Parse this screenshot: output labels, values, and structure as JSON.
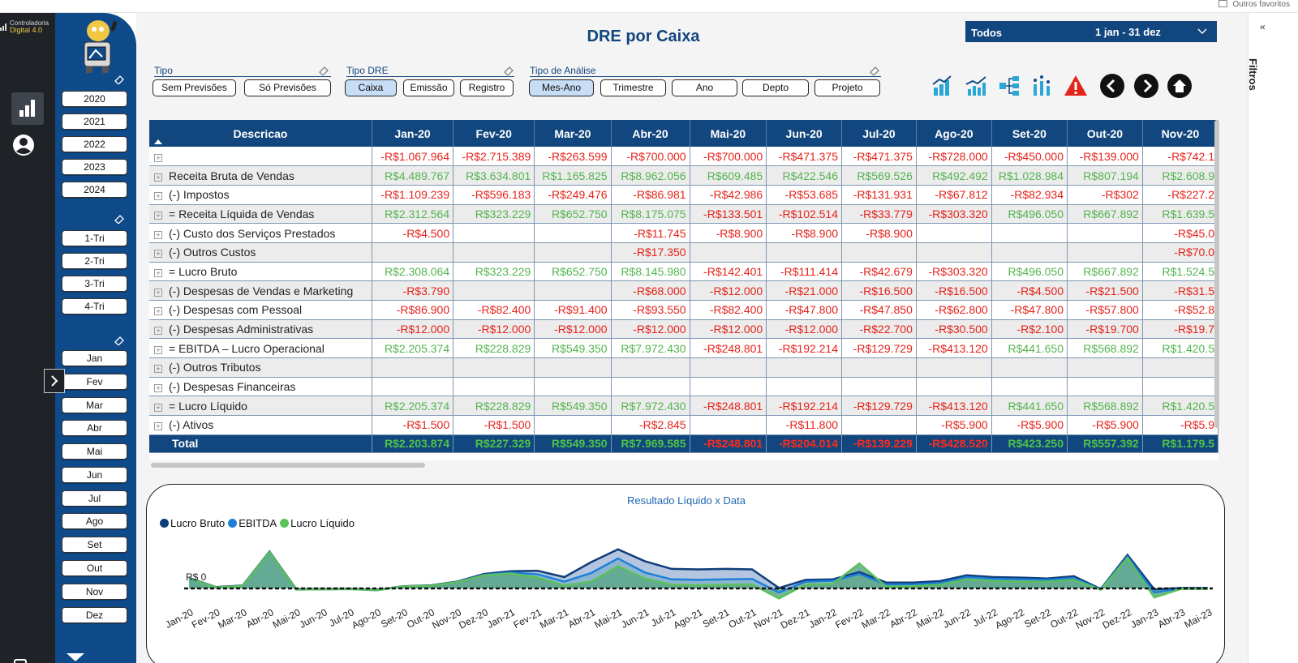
{
  "browser": {
    "favorites_label": "Outros favoritos"
  },
  "brand": {
    "line1": "Controladoria",
    "line2": "Digital 4.0"
  },
  "header": {
    "title": "DRE por Caixa",
    "date_filter": {
      "scope": "Todos",
      "range": "1 jan - 31 dez"
    }
  },
  "left_panel": {
    "years": [
      "2020",
      "2021",
      "2022",
      "2023",
      "2024"
    ],
    "quarters": [
      "1-Tri",
      "2-Tri",
      "3-Tri",
      "4-Tri"
    ],
    "months": [
      "Jan",
      "Fev",
      "Mar",
      "Abr",
      "Mai",
      "Jun",
      "Jul",
      "Ago",
      "Set",
      "Out",
      "Nov",
      "Dez"
    ]
  },
  "filters": {
    "tipo": {
      "label": "Tipo",
      "options": [
        "Sem Previsões",
        "Só Previsões"
      ]
    },
    "tipo_dre": {
      "label": "Tipo DRE",
      "options": [
        "Caixa",
        "Emissão",
        "Registro"
      ],
      "selected": "Caixa"
    },
    "tipo_analise": {
      "label": "Tipo de Análise",
      "options": [
        "Mes-Ano",
        "Trimestre",
        "Ano",
        "Depto",
        "Projeto"
      ],
      "selected": "Mes-Ano"
    }
  },
  "table": {
    "columns": [
      "Descricao",
      "Jan-20",
      "Fev-20",
      "Mar-20",
      "Abr-20",
      "Mai-20",
      "Jun-20",
      "Jul-20",
      "Ago-20",
      "Set-20",
      "Out-20",
      "Nov-20"
    ],
    "rows": [
      {
        "label": "",
        "values": [
          "-R$1.067.964",
          "-R$2.715.389",
          "-R$263.599",
          "-R$700.000",
          "-R$700.000",
          "-R$471.375",
          "-R$471.375",
          "-R$728.000",
          "-R$450.000",
          "-R$139.000",
          "-R$742.1"
        ]
      },
      {
        "label": "Receita Bruta de Vendas",
        "values": [
          "R$4.489.767",
          "R$3.634.801",
          "R$1.165.825",
          "R$8.962.056",
          "R$609.485",
          "R$422.546",
          "R$569.526",
          "R$492.492",
          "R$1.028.984",
          "R$807.194",
          "R$2.608.9"
        ]
      },
      {
        "label": "(-) Impostos",
        "values": [
          "-R$1.109.239",
          "-R$596.183",
          "-R$249.476",
          "-R$86.981",
          "-R$42.986",
          "-R$53.685",
          "-R$131.931",
          "-R$67.812",
          "-R$82.934",
          "-R$302",
          "-R$227.2"
        ]
      },
      {
        "label": "= Receita Líquida de Vendas",
        "values": [
          "R$2.312.564",
          "R$323.229",
          "R$652.750",
          "R$8.175.075",
          "-R$133.501",
          "-R$102.514",
          "-R$33.779",
          "-R$303.320",
          "R$496.050",
          "R$667.892",
          "R$1.639.5"
        ]
      },
      {
        "label": "(-) Custo dos Serviços Prestados",
        "values": [
          "-R$4.500",
          "",
          "",
          "-R$11.745",
          "-R$8.900",
          "-R$8.900",
          "-R$8.900",
          "",
          "",
          "",
          "-R$45.0"
        ]
      },
      {
        "label": "(-) Outros Custos",
        "values": [
          "",
          "",
          "",
          "-R$17.350",
          "",
          "",
          "",
          "",
          "",
          "",
          "-R$70.0"
        ]
      },
      {
        "label": "= Lucro Bruto",
        "values": [
          "R$2.308.064",
          "R$323.229",
          "R$652.750",
          "R$8.145.980",
          "-R$142.401",
          "-R$111.414",
          "-R$42.679",
          "-R$303.320",
          "R$496.050",
          "R$667.892",
          "R$1.524.5"
        ]
      },
      {
        "label": "(-) Despesas de Vendas e Marketing",
        "values": [
          "-R$3.790",
          "",
          "",
          "-R$68.000",
          "-R$12.000",
          "-R$21.000",
          "-R$16.500",
          "-R$16.500",
          "-R$4.500",
          "-R$21.500",
          "-R$31.5"
        ]
      },
      {
        "label": "(-) Despesas com Pessoal",
        "values": [
          "-R$86.900",
          "-R$82.400",
          "-R$91.400",
          "-R$93.550",
          "-R$82.400",
          "-R$47.800",
          "-R$47.850",
          "-R$62.800",
          "-R$47.800",
          "-R$57.800",
          "-R$52.8"
        ]
      },
      {
        "label": "(-) Despesas Administrativas",
        "values": [
          "-R$12.000",
          "-R$12.000",
          "-R$12.000",
          "-R$12.000",
          "-R$12.000",
          "-R$12.000",
          "-R$22.700",
          "-R$30.500",
          "-R$2.100",
          "-R$19.700",
          "-R$19.7"
        ]
      },
      {
        "label": "= EBITDA – Lucro Operacional",
        "values": [
          "R$2.205.374",
          "R$228.829",
          "R$549.350",
          "R$7.972.430",
          "-R$248.801",
          "-R$192.214",
          "-R$129.729",
          "-R$413.120",
          "R$441.650",
          "R$568.892",
          "R$1.420.5"
        ]
      },
      {
        "label": "(-) Outros Tributos",
        "values": [
          "",
          "",
          "",
          "",
          "",
          "",
          "",
          "",
          "",
          "",
          ""
        ]
      },
      {
        "label": "(-) Despesas Financeiras",
        "values": [
          "",
          "",
          "",
          "",
          "",
          "",
          "",
          "",
          "",
          "",
          ""
        ]
      },
      {
        "label": "= Lucro Líquido",
        "values": [
          "R$2.205.374",
          "R$228.829",
          "R$549.350",
          "R$7.972.430",
          "-R$248.801",
          "-R$192.214",
          "-R$129.729",
          "-R$413.120",
          "R$441.650",
          "R$568.892",
          "R$1.420.5"
        ]
      },
      {
        "label": "(-) Ativos",
        "values": [
          "-R$1.500",
          "-R$1.500",
          "",
          "-R$2.845",
          "",
          "-R$11.800",
          "",
          "-R$5.900",
          "-R$5.900",
          "-R$5.900",
          "-R$5.9"
        ]
      }
    ],
    "total": {
      "label": "Total",
      "values": [
        "R$2.203.874",
        "R$227.329",
        "R$549.350",
        "R$7.969.585",
        "-R$248.801",
        "-R$204.014",
        "-R$139.229",
        "-R$428.520",
        "R$423.250",
        "R$557.392",
        "R$1.179.5"
      ]
    }
  },
  "chart_data": {
    "type": "area",
    "title": "Resultado Líquido x Data",
    "legend": "top-left",
    "y_tick_labels": [
      "R$ 0"
    ],
    "categories": [
      "Jan-20",
      "Fev-20",
      "Mar-20",
      "Abr-20",
      "Mai-20",
      "Jun-20",
      "Jul-20",
      "Ago-20",
      "Set-20",
      "Out-20",
      "Nov-20",
      "Dez-20",
      "Jan-21",
      "Fev-21",
      "Mar-21",
      "Abr-21",
      "Mai-21",
      "Jun-21",
      "Jul-21",
      "Ago-21",
      "Set-21",
      "Out-21",
      "Nov-21",
      "Dez-21",
      "Jan-22",
      "Fev-22",
      "Mar-22",
      "Abr-22",
      "Mai-22",
      "Jun-22",
      "Jul-22",
      "Ago-22",
      "Set-22",
      "Out-22",
      "Nov-22",
      "Dez-22",
      "Jan-23",
      "Abr-23",
      "Mai-23"
    ],
    "series": [
      {
        "name": "Lucro Bruto",
        "color": "#0f3d7a",
        "values": [
          2.3,
          0.3,
          0.65,
          8.1,
          -0.14,
          -0.11,
          -0.04,
          -0.3,
          0.5,
          0.67,
          1.5,
          3.2,
          3.8,
          3.9,
          2.5,
          5.8,
          8.6,
          6.0,
          4.3,
          4.2,
          4.3,
          4.2,
          0.1,
          1.9,
          2.0,
          3.6,
          1.3,
          1.3,
          1.6,
          2.9,
          2.5,
          2.4,
          2.2,
          2.7,
          -0.1,
          7.4,
          -0.2,
          0.1,
          0.1
        ]
      },
      {
        "name": "EBITDA",
        "color": "#1e7fd8",
        "values": [
          2.2,
          0.23,
          0.55,
          7.97,
          -0.25,
          -0.19,
          -0.13,
          -0.41,
          0.44,
          0.57,
          1.4,
          3.0,
          3.5,
          3.1,
          1.5,
          3.4,
          6.6,
          3.5,
          2.0,
          1.9,
          2.0,
          2.1,
          -0.9,
          1.5,
          1.7,
          3.2,
          0.9,
          0.9,
          1.2,
          2.5,
          2.1,
          2.0,
          1.9,
          2.3,
          -0.2,
          7.0,
          -0.9,
          0.0,
          0.0
        ]
      },
      {
        "name": "Lucro Líquido",
        "color": "#5bc15a",
        "values": [
          2.2,
          0.23,
          0.55,
          7.97,
          -0.25,
          -0.19,
          -0.13,
          -0.41,
          0.44,
          0.57,
          1.4,
          2.9,
          3.3,
          2.4,
          0.6,
          1.5,
          4.9,
          2.2,
          0.8,
          0.7,
          0.8,
          0.9,
          -2.2,
          0.9,
          1.0,
          5.5,
          0.4,
          0.5,
          0.8,
          2.0,
          1.6,
          1.5,
          1.5,
          1.9,
          -0.3,
          6.7,
          -2.0,
          -0.1,
          -0.1
        ]
      }
    ]
  },
  "right_panel": {
    "label": "Filtros"
  }
}
